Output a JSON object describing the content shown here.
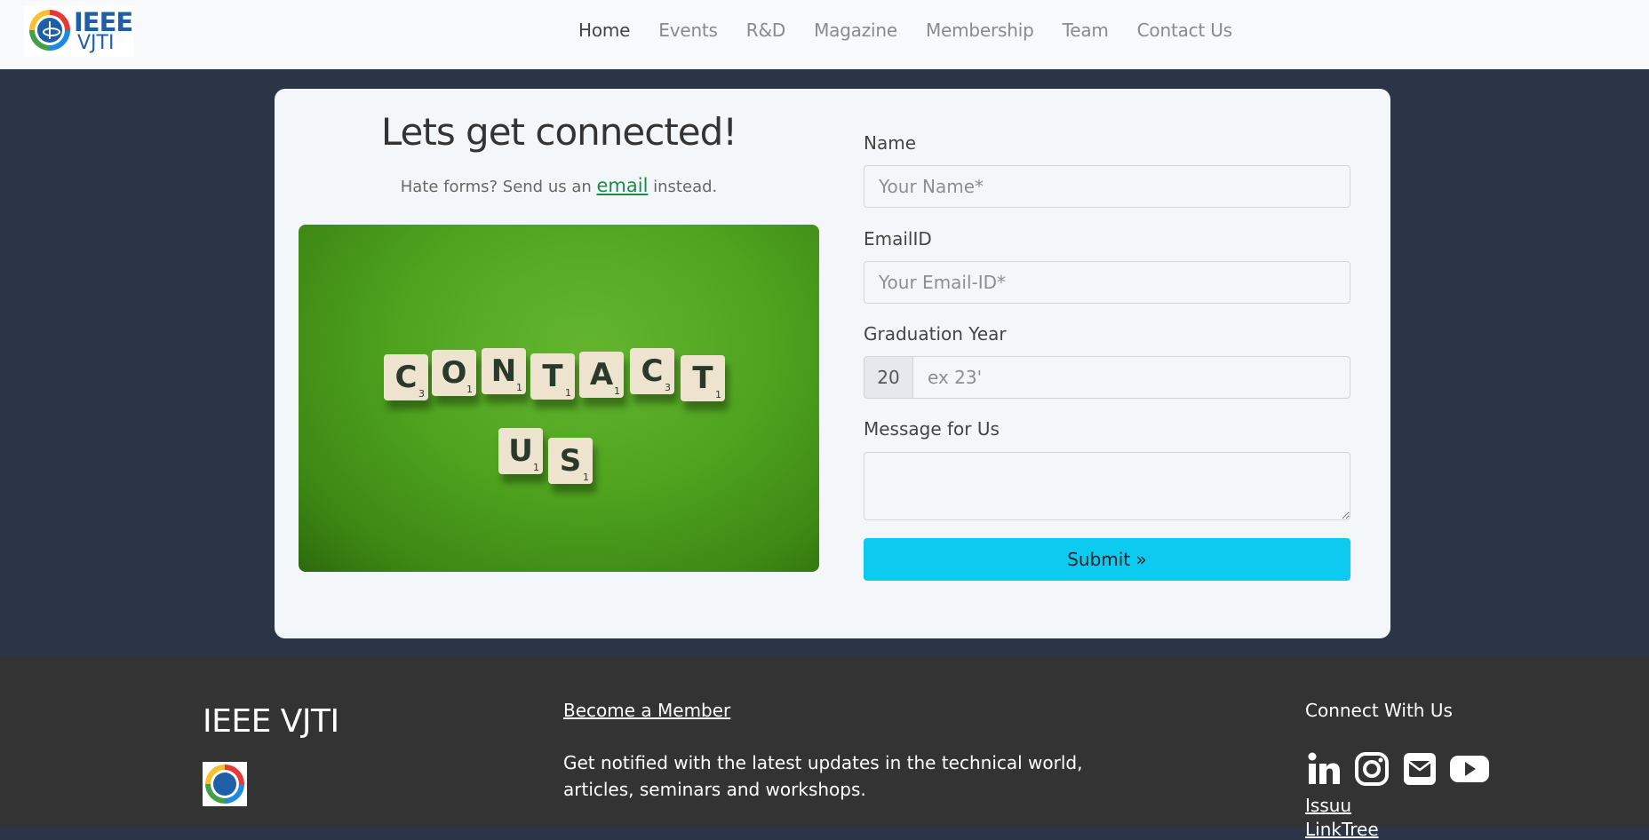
{
  "brand": {
    "logo_text_top": "IEEE",
    "logo_text_bottom": "VJTI"
  },
  "nav": {
    "items": [
      {
        "label": "Home",
        "active": true
      },
      {
        "label": "Events"
      },
      {
        "label": "R&D"
      },
      {
        "label": "Magazine"
      },
      {
        "label": "Membership"
      },
      {
        "label": "Team"
      },
      {
        "label": "Contact Us"
      }
    ]
  },
  "contact": {
    "heading": "Lets get connected!",
    "sub_prefix": "Hate forms? Send us an ",
    "sub_link": "email",
    "sub_suffix": " instead.",
    "image_tiles_row1": [
      "C",
      "O",
      "N",
      "T",
      "A",
      "C",
      "T"
    ],
    "image_tiles_row2": [
      "U",
      "S"
    ]
  },
  "form": {
    "name_label": "Name",
    "name_placeholder": "Your Name*",
    "email_label": "EmailID",
    "email_placeholder": "Your Email-ID*",
    "grad_label": "Graduation Year",
    "grad_prefix": "20",
    "grad_placeholder": "ex 23'",
    "message_label": "Message for Us",
    "submit_label": "Submit »"
  },
  "footer": {
    "title": "IEEE VJTI",
    "member_link": "Become a Member",
    "text": "Get notified with the latest updates in the technical world, articles, seminars and workshops.",
    "connect_title": "Connect With Us",
    "issuu": "Issuu",
    "linktree": "LinkTree"
  },
  "colors": {
    "navbar_bg": "#f8f9fa",
    "page_bg": "#2c3547",
    "card_bg": "#f4f7fa",
    "submit_bg": "#0dcaf0",
    "footer_bg": "#333333",
    "link_green": "#1e8a4a"
  }
}
